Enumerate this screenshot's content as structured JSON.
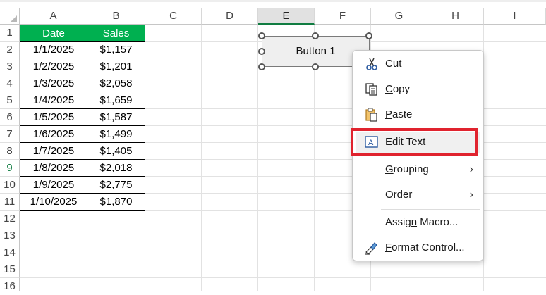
{
  "columns": [
    "A",
    "B",
    "C",
    "D",
    "E",
    "F",
    "G",
    "H",
    "I"
  ],
  "selected_column": "E",
  "rows": [
    "1",
    "2",
    "3",
    "4",
    "5",
    "6",
    "7",
    "8",
    "9",
    "10",
    "11",
    "12",
    "13",
    "14",
    "15",
    "16"
  ],
  "highlighted_row": "9",
  "table": {
    "headers": [
      "Date",
      "Sales"
    ],
    "rows": [
      [
        "1/1/2025",
        "$1,157"
      ],
      [
        "1/2/2025",
        "$1,201"
      ],
      [
        "1/3/2025",
        "$2,058"
      ],
      [
        "1/4/2025",
        "$1,659"
      ],
      [
        "1/5/2025",
        "$1,587"
      ],
      [
        "1/6/2025",
        "$1,499"
      ],
      [
        "1/7/2025",
        "$1,405"
      ],
      [
        "1/8/2025",
        "$2,018"
      ],
      [
        "1/9/2025",
        "$2,775"
      ],
      [
        "1/10/2025",
        "$1,870"
      ]
    ]
  },
  "form_button": {
    "label": "Button 1"
  },
  "context_menu": {
    "items": [
      {
        "label": "Cut",
        "icon": "scissors-icon",
        "underline": "t"
      },
      {
        "label": "Copy",
        "icon": "copy-icon",
        "underline": "C"
      },
      {
        "label": "Paste",
        "icon": "paste-icon",
        "underline": "P"
      },
      {
        "label": "Edit Text",
        "icon": "edit-text-icon",
        "underline": "x",
        "highlighted": true
      },
      {
        "label": "Grouping",
        "icon": "",
        "submenu": true,
        "underline": "G"
      },
      {
        "label": "Order",
        "icon": "",
        "submenu": true,
        "underline": "O"
      },
      {
        "label": "Assign Macro...",
        "icon": "",
        "underline": "n"
      },
      {
        "label": "Format Control...",
        "icon": "format-control-icon",
        "underline": "F"
      }
    ],
    "chevron": "›"
  },
  "colors": {
    "header_fill": "#00b050",
    "accent_green": "#107c41",
    "highlight_border": "#e0232e"
  }
}
